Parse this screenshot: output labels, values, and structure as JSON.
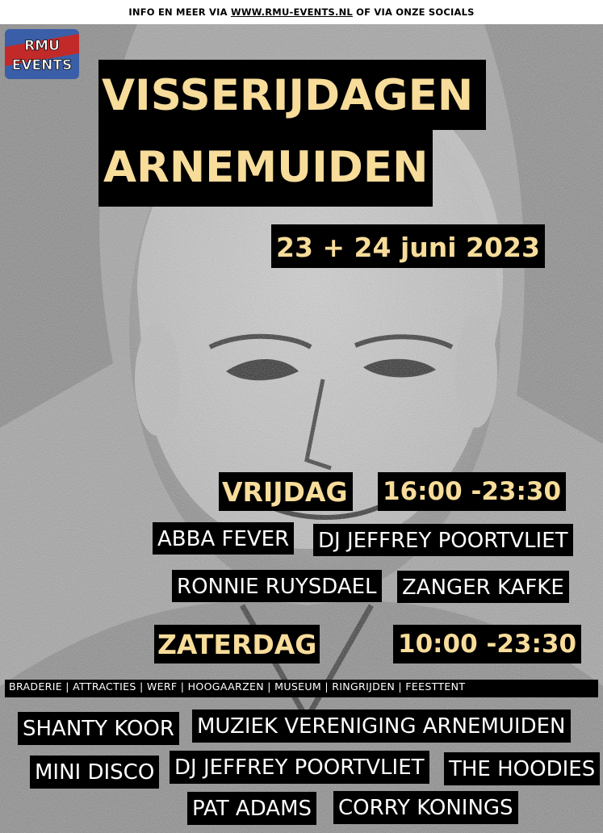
{
  "topbar": {
    "prefix": "INFO EN MEER VIA",
    "link": "WWW.RMU-EVENTS.NL",
    "suffix": "OF VIA ONZE SOCIALS"
  },
  "logo": {
    "line1": "RMU",
    "line2": "EVENTS"
  },
  "title": {
    "line1": "VISSERIJDAGEN",
    "line2": "ARNEMUIDEN"
  },
  "date": "23 + 24 juni 2023",
  "friday": {
    "day": "VRIJDAG",
    "time": "16:00 -23:30",
    "acts": [
      "ABBA FEVER",
      "DJ JEFFREY POORTVLIET",
      "RONNIE RUYSDAEL",
      "ZANGER KAFKE"
    ]
  },
  "saturday": {
    "day": "ZATERDAG",
    "time": "10:00 -23:30",
    "activities": "BRADERIE | ATTRACTIES | WERF | HOOGAARZEN | MUSEUM | RINGRIJDEN | FEESTTENT",
    "acts": [
      "SHANTY KOOR",
      "MUZIEK VERENIGING ARNEMUIDEN",
      "MINI DISCO",
      "DJ JEFFREY POORTVLIET",
      "THE HOODIES",
      "PAT ADAMS",
      "CORRY KONINGS"
    ]
  },
  "colors": {
    "accent": "#f7dc9a",
    "block": "#000000",
    "photo": "#9a9a9a"
  }
}
